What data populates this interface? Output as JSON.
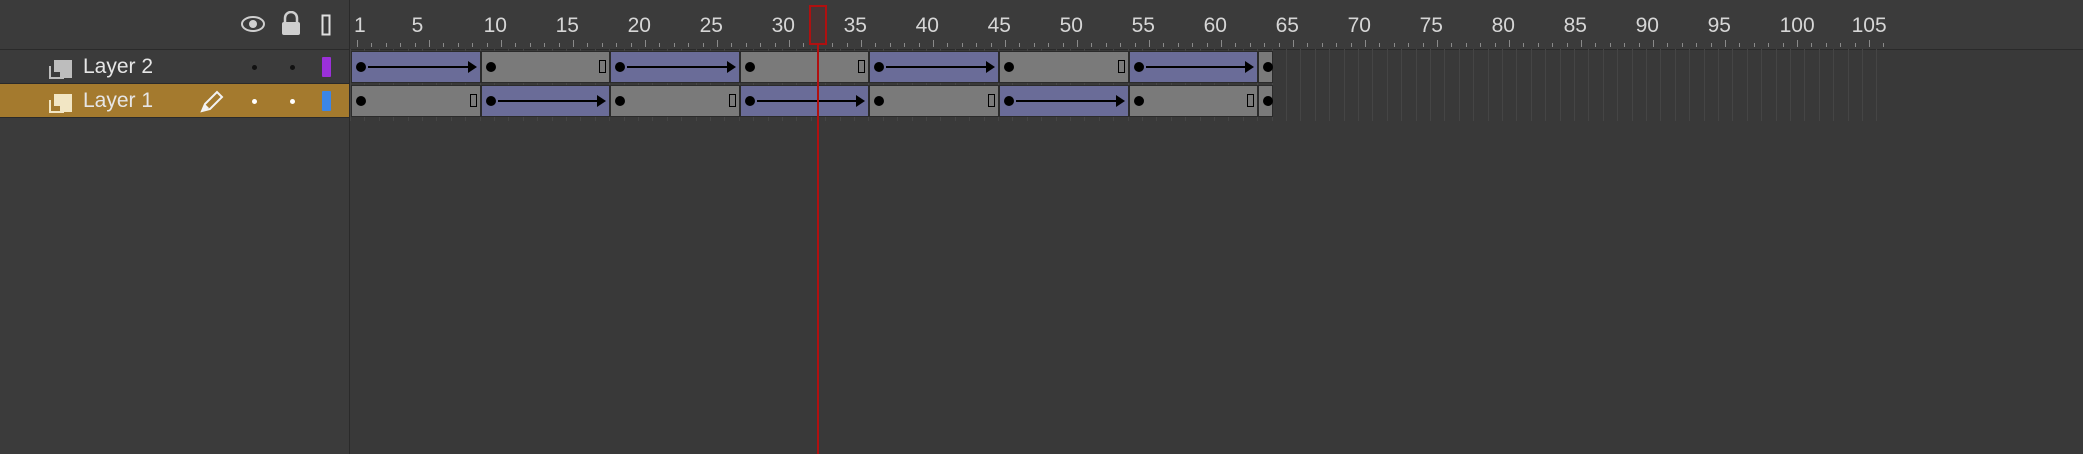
{
  "header": {
    "eye_icon": "eye-icon",
    "lock_icon": "lock-icon",
    "outline_icon": "outline-icon"
  },
  "layers": [
    {
      "name": "Layer 2",
      "color": "#9b30d9",
      "selected": false
    },
    {
      "name": "Layer 1",
      "color": "#3c86e6",
      "selected": true
    }
  ],
  "ruler": {
    "labels": [
      "1",
      "5",
      "10",
      "15",
      "20",
      "25",
      "30",
      "35",
      "40",
      "45",
      "50",
      "55",
      "60",
      "65",
      "70",
      "75",
      "80",
      "85",
      "90",
      "95",
      "100",
      "105"
    ],
    "label_frames": [
      1,
      5,
      10,
      15,
      20,
      25,
      30,
      35,
      40,
      45,
      50,
      55,
      60,
      65,
      70,
      75,
      80,
      85,
      90,
      95,
      100,
      105
    ],
    "total_frames": 107
  },
  "playhead": {
    "frame": 33
  },
  "tracks": [
    {
      "layer": "Layer 2",
      "spans": [
        {
          "start": 1,
          "end": 9,
          "tween": true
        },
        {
          "start": 10,
          "end": 18,
          "tween": false
        },
        {
          "start": 19,
          "end": 27,
          "tween": true
        },
        {
          "start": 28,
          "end": 36,
          "tween": false
        },
        {
          "start": 37,
          "end": 45,
          "tween": true
        },
        {
          "start": 46,
          "end": 54,
          "tween": false
        },
        {
          "start": 55,
          "end": 63,
          "tween": true
        },
        {
          "start": 64,
          "end": 64,
          "tween": false
        }
      ]
    },
    {
      "layer": "Layer 1",
      "spans": [
        {
          "start": 1,
          "end": 9,
          "tween": false
        },
        {
          "start": 10,
          "end": 18,
          "tween": true
        },
        {
          "start": 19,
          "end": 27,
          "tween": false
        },
        {
          "start": 28,
          "end": 36,
          "tween": true
        },
        {
          "start": 37,
          "end": 45,
          "tween": false
        },
        {
          "start": 46,
          "end": 54,
          "tween": true
        },
        {
          "start": 55,
          "end": 63,
          "tween": false
        },
        {
          "start": 64,
          "end": 64,
          "tween": false
        }
      ]
    }
  ]
}
